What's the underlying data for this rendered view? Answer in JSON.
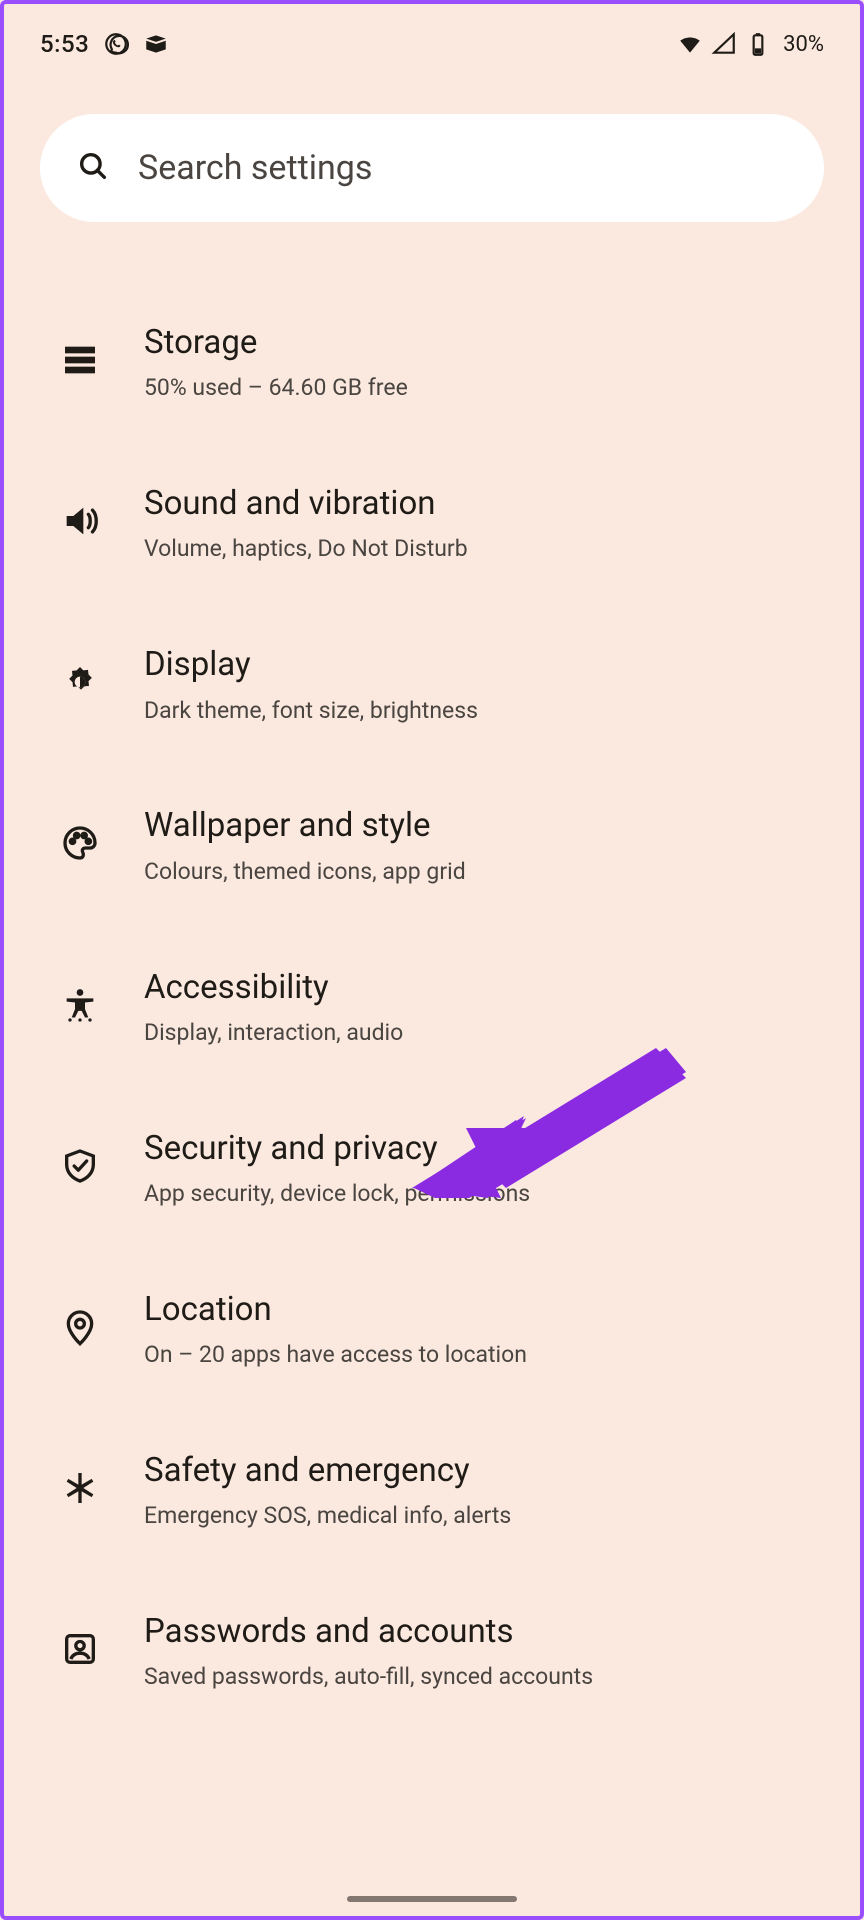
{
  "status": {
    "clock": "5:53",
    "battery": "30%"
  },
  "search": {
    "placeholder": "Search settings"
  },
  "items": [
    {
      "title": "Storage",
      "sub": "50% used – 64.60 GB free"
    },
    {
      "title": "Sound and vibration",
      "sub": "Volume, haptics, Do Not Disturb"
    },
    {
      "title": "Display",
      "sub": "Dark theme, font size, brightness"
    },
    {
      "title": "Wallpaper and style",
      "sub": "Colours, themed icons, app grid"
    },
    {
      "title": "Accessibility",
      "sub": "Display, interaction, audio"
    },
    {
      "title": "Security and privacy",
      "sub": "App security, device lock, permissions"
    },
    {
      "title": "Location",
      "sub": "On – 20 apps have access to location"
    },
    {
      "title": "Safety and emergency",
      "sub": "Emergency SOS, medical info, alerts"
    },
    {
      "title": "Passwords and accounts",
      "sub": "Saved passwords, auto-fill, synced accounts"
    }
  ]
}
